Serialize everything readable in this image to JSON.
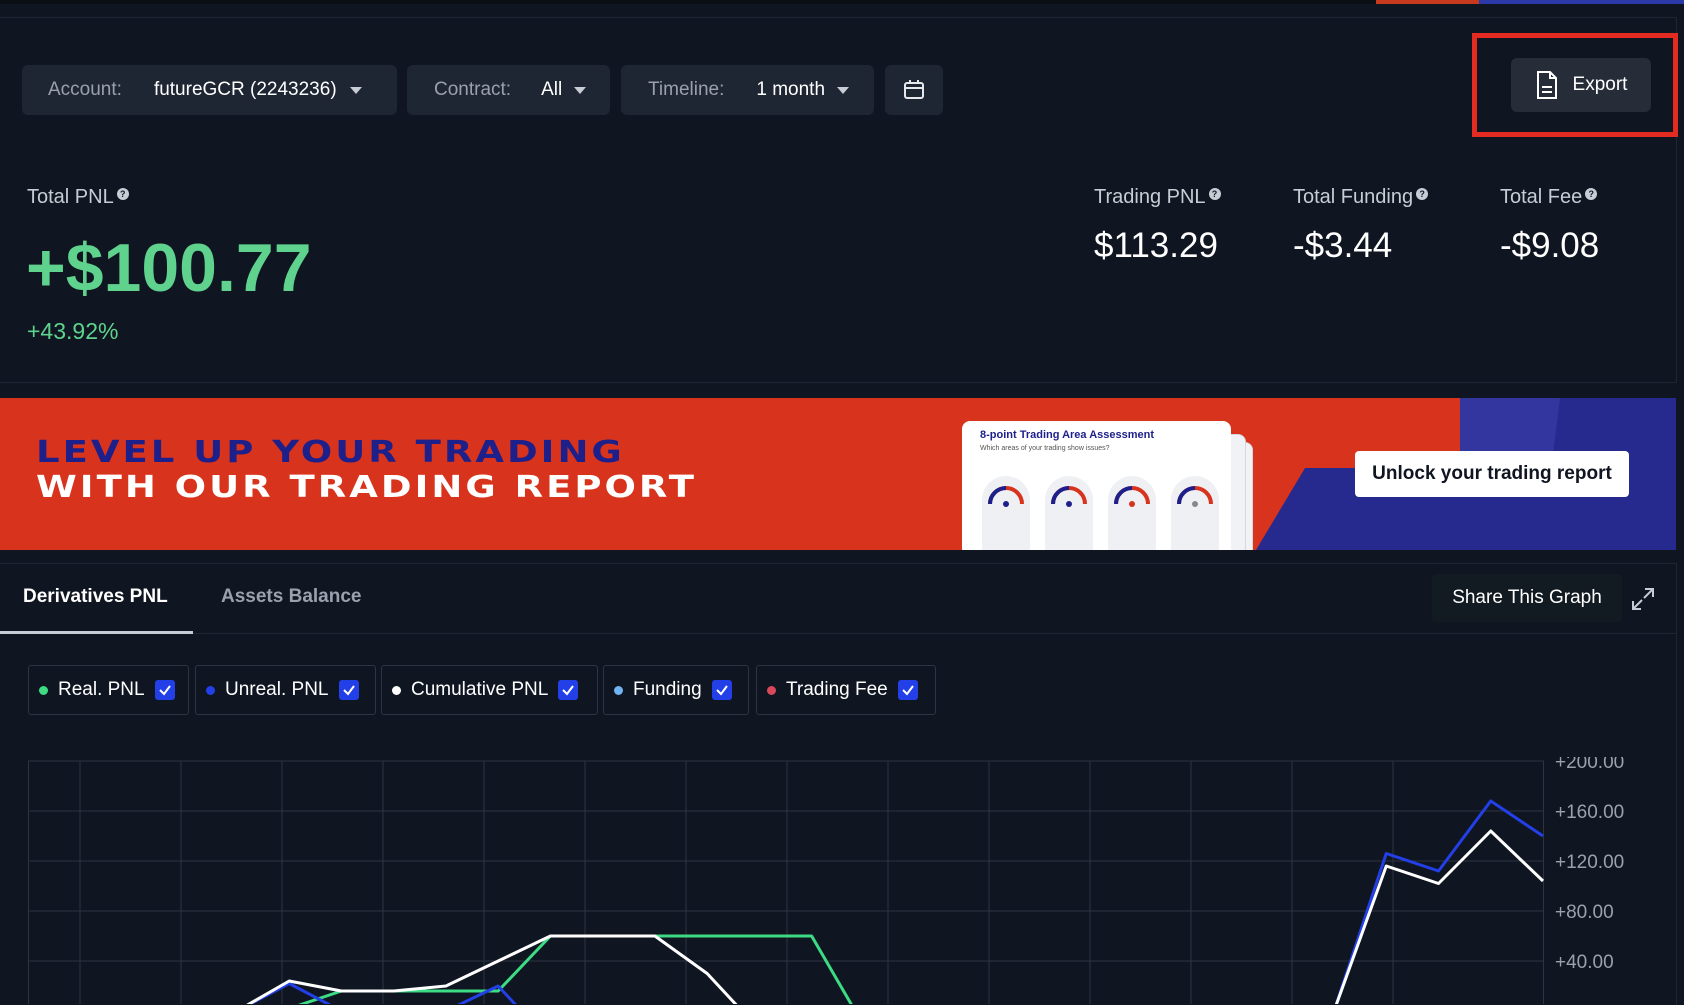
{
  "filters": {
    "account": {
      "label": "Account:",
      "value": "futureGCR (2243236)"
    },
    "contract": {
      "label": "Contract:",
      "value": "All"
    },
    "timeline": {
      "label": "Timeline:",
      "value": "1 month"
    }
  },
  "export": {
    "label": "Export"
  },
  "summary": {
    "total_pnl_label": "Total PNL",
    "total_pnl_value": "+$100.77",
    "total_pnl_percent": "+43.92%",
    "trading_pnl_label": "Trading PNL",
    "trading_pnl_value": "$113.29",
    "total_funding_label": "Total Funding",
    "total_funding_value": "-$3.44",
    "total_fee_label": "Total Fee",
    "total_fee_value": "-$9.08"
  },
  "banner": {
    "line1": "LEVEL UP YOUR TRADING",
    "line2": "WITH OUR TRADING REPORT",
    "card_title": "8-point Trading Area Assessment",
    "card_subtitle": "Which areas of your trading show issues?",
    "button_label": "Unlock your trading report"
  },
  "tabs": [
    {
      "label": "Derivatives PNL",
      "active": true
    },
    {
      "label": "Assets Balance",
      "active": false
    }
  ],
  "share": {
    "label": "Share This Graph"
  },
  "legend": [
    {
      "label": "Real. PNL",
      "color": "#3ddc84",
      "checked": true
    },
    {
      "label": "Unreal. PNL",
      "color": "#2340e8",
      "checked": true
    },
    {
      "label": "Cumulative PNL",
      "color": "#ffffff",
      "checked": true
    },
    {
      "label": "Funding",
      "color": "#6fb3f2",
      "checked": true
    },
    {
      "label": "Trading Fee",
      "color": "#d8485a",
      "checked": true
    }
  ],
  "colors": {
    "positive": "#5fd38d",
    "accent_red": "#e32b22",
    "banner_bg": "#d8341d"
  },
  "chart_data": {
    "type": "line",
    "y_ticks": [
      "+200.00",
      "+160.00",
      "+120.00",
      "+80.00",
      "+40.00"
    ],
    "ylim": [
      0,
      200
    ],
    "grid": true,
    "x": [
      0,
      1,
      2,
      3,
      4,
      5,
      6,
      7,
      8,
      9,
      10,
      11,
      12,
      13,
      14,
      15,
      16,
      17,
      18,
      19,
      20,
      21,
      22,
      23,
      24,
      25,
      26,
      27,
      28,
      29
    ],
    "series": [
      {
        "name": "Real. PNL",
        "color": "#3ddc84",
        "values": [
          null,
          null,
          null,
          null,
          null,
          2,
          16,
          16,
          16,
          16,
          60,
          60,
          60,
          60,
          60,
          60,
          -12,
          null,
          null,
          null,
          null,
          null,
          null,
          null,
          null,
          null,
          null,
          null,
          null,
          null
        ]
      },
      {
        "name": "Unreal. PNL",
        "color": "#2340e8",
        "values": [
          null,
          null,
          null,
          null,
          0,
          22,
          0,
          null,
          0,
          20,
          -25,
          null,
          null,
          null,
          null,
          null,
          null,
          null,
          null,
          null,
          null,
          null,
          null,
          null,
          null,
          0,
          126,
          112,
          168,
          140
        ]
      },
      {
        "name": "Cumulative PNL",
        "color": "#ffffff",
        "values": [
          null,
          null,
          null,
          null,
          0,
          24,
          16,
          16,
          20,
          40,
          60,
          60,
          60,
          30,
          -15,
          null,
          null,
          null,
          null,
          null,
          null,
          null,
          null,
          null,
          null,
          0,
          116,
          102,
          144,
          104
        ]
      }
    ]
  }
}
